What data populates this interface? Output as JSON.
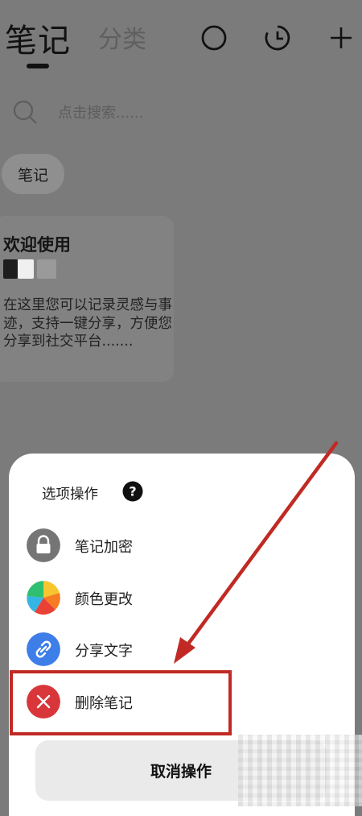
{
  "header": {
    "tab_notes": "笔记",
    "tab_category": "分类",
    "icons": [
      "circle-icon",
      "clock-icon",
      "plus-icon"
    ]
  },
  "search": {
    "placeholder": "点击搜索......"
  },
  "filter_chip": "笔记",
  "note_card": {
    "title": "欢迎使用",
    "body": "在这里您可以记录灵感与事迹，支持一键分享，方便您分享到社交平台......."
  },
  "sheet": {
    "title": "选项操作",
    "options": [
      {
        "label": "笔记加密",
        "icon": "lock-icon",
        "color": "#757575"
      },
      {
        "label": "颜色更改",
        "icon": "color-wheel-icon",
        "color": "#f5a623"
      },
      {
        "label": "分享文字",
        "icon": "link-icon",
        "color": "#3d7ee8"
      },
      {
        "label": "删除笔记",
        "icon": "close-icon",
        "color": "#d8363a"
      }
    ],
    "cancel_label": "取消操作"
  },
  "colors": {
    "overlay": "#7b7b7b",
    "highlight": "#c12a24",
    "sheet_bg": "#ffffff"
  }
}
